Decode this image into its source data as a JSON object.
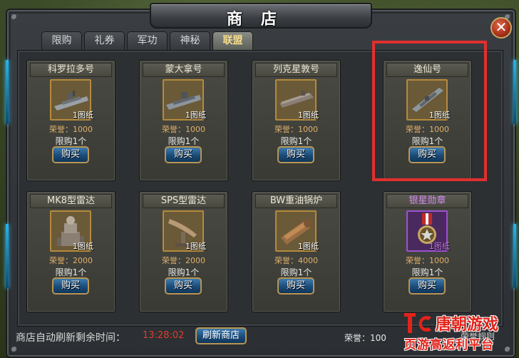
{
  "window": {
    "title": "商店",
    "close_symbol": "✕"
  },
  "tabs": [
    {
      "label": "限购",
      "active": false
    },
    {
      "label": "礼券",
      "active": false
    },
    {
      "label": "军功",
      "active": false
    },
    {
      "label": "神秘",
      "active": false
    },
    {
      "label": "联盟",
      "active": true
    }
  ],
  "items": [
    {
      "name": "科罗拉多号",
      "quantity": "1图纸",
      "honor": "荣誉：1000",
      "limit": "限购1个",
      "buy": "购买",
      "icon": "battleship-icon",
      "rarity_color": "#b58a3c"
    },
    {
      "name": "蒙大拿号",
      "quantity": "1图纸",
      "honor": "荣誉：1000",
      "limit": "限购1个",
      "buy": "购买",
      "icon": "battleship-icon",
      "rarity_color": "#b58a3c"
    },
    {
      "name": "列克星敦号",
      "quantity": "1图纸",
      "honor": "荣誉：1000",
      "limit": "限购1个",
      "buy": "购买",
      "icon": "carrier-icon",
      "rarity_color": "#b58a3c"
    },
    {
      "name": "逸仙号",
      "quantity": "1图纸",
      "honor": "荣誉：1000",
      "limit": "限购1个",
      "buy": "购买",
      "icon": "cruiser-icon",
      "rarity_color": "#b58a3c"
    },
    {
      "name": "MK8型雷达",
      "quantity": "1图纸",
      "honor": "荣誉：2000",
      "limit": "限购1个",
      "buy": "购买",
      "icon": "radar-tower-icon",
      "rarity_color": "#b58a3c"
    },
    {
      "name": "SPS型雷达",
      "quantity": "1图纸",
      "honor": "荣誉：2000",
      "limit": "限购1个",
      "buy": "购买",
      "icon": "radar-dish-icon",
      "rarity_color": "#b58a3c"
    },
    {
      "name": "BW重油锅炉",
      "quantity": "1图纸",
      "honor": "荣誉：4000",
      "limit": "限购1个",
      "buy": "购买",
      "icon": "boiler-icon",
      "rarity_color": "#b58a3c"
    },
    {
      "name": "银星勋章",
      "quantity": "1图纸",
      "honor": "荣誉：1000",
      "limit": "限购1个",
      "buy": "购买",
      "icon": "silver-star-medal-icon",
      "rarity_color": "#9c52d0"
    }
  ],
  "footer": {
    "refresh_label": "商店自动刷新剩余时间：",
    "refresh_timer": "13:28:02",
    "refresh_button": "刷新商店",
    "honor_total": "荣誉：100",
    "honor_rules": "荣誉规则"
  },
  "watermark": {
    "line1": "唐朝游戏",
    "line2": "页游高返利平台",
    "logo": "tc-logo"
  },
  "colors": {
    "highlight_box": "#e0302e",
    "timer": "#e33c2a",
    "honor_text": "#e0b06a",
    "active_tab_text": "#f4dc8c"
  }
}
